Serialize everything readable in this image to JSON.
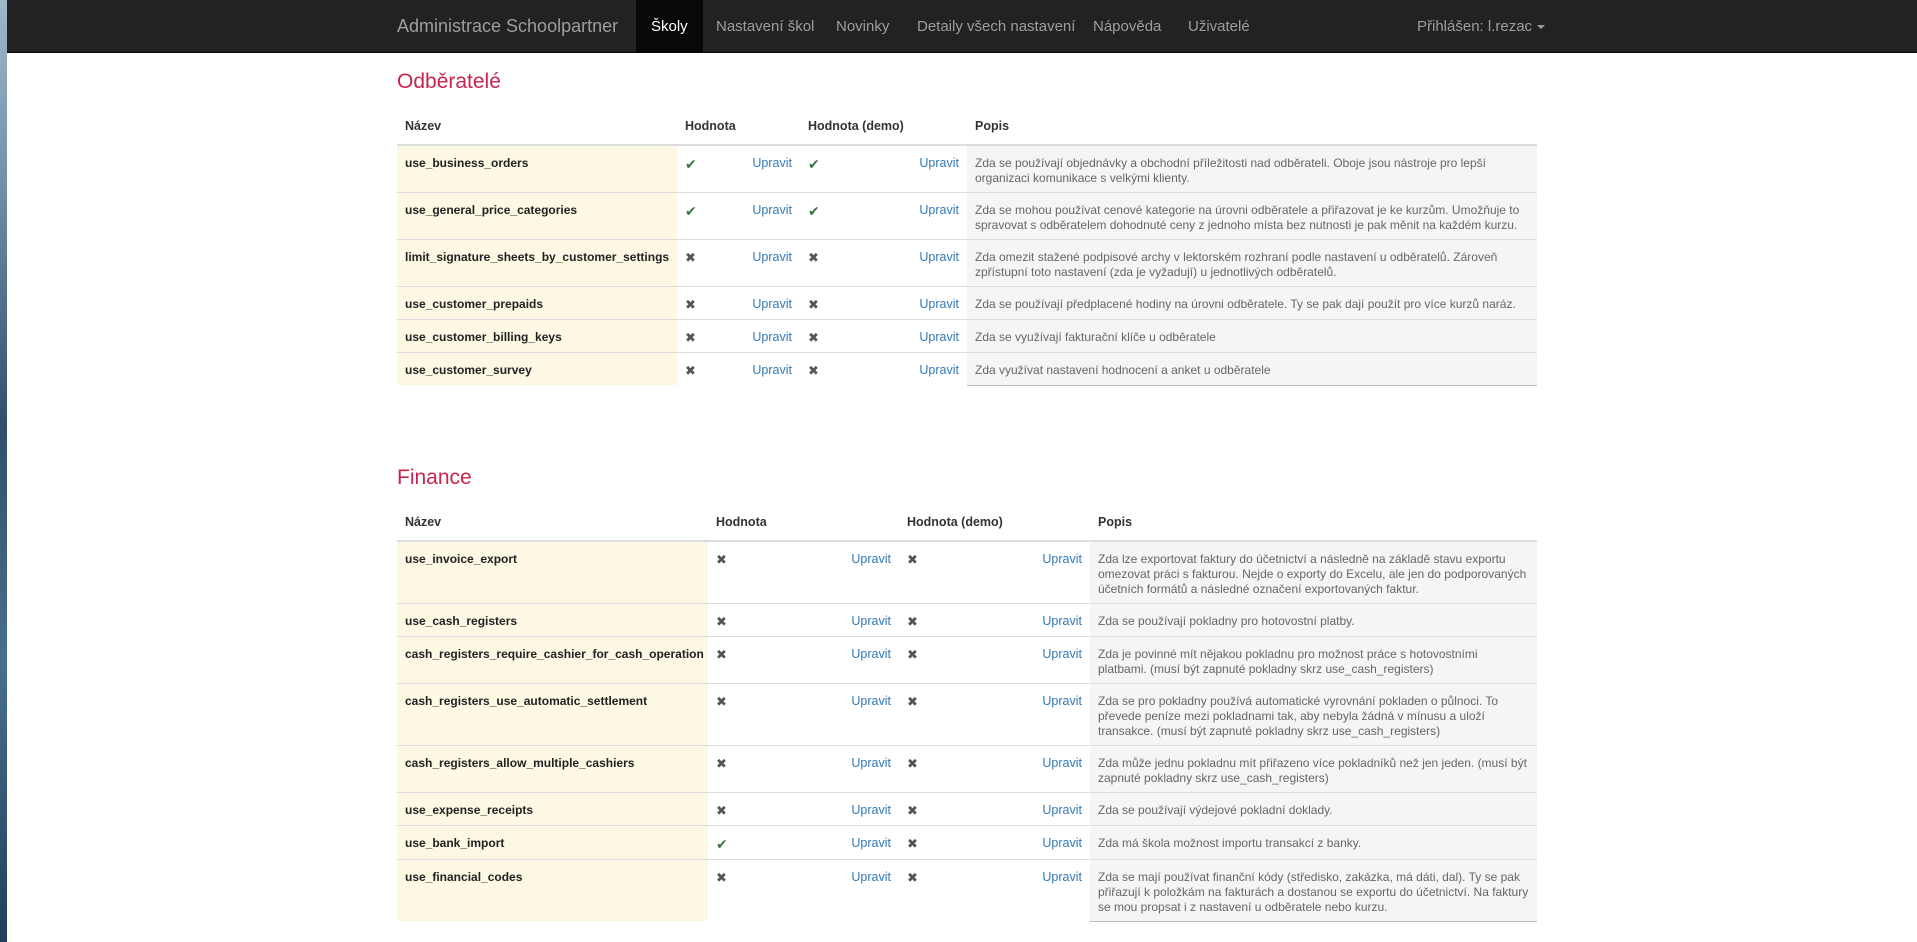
{
  "nav": {
    "brand": "Administrace Schoolpartner",
    "items": [
      "Školy",
      "Nastavení škol",
      "Novinky",
      "Detaily všech nastavení",
      "Nápověda",
      "Uživatelé"
    ],
    "user": "Přihlášen: l.rezac"
  },
  "headers": {
    "name": "Název",
    "value": "Hodnota",
    "value_demo": "Hodnota (demo)",
    "desc": "Popis",
    "edit": "Upravit"
  },
  "sections": [
    {
      "title": "Odběratelé",
      "rows": [
        {
          "name": "use_business_orders",
          "value": "check",
          "demo": "check",
          "desc": "Zda se používají objednávky a obchodní příležitosti nad odběrateli. Oboje jsou nástroje pro lepší organizaci komunikace s velkými klienty."
        },
        {
          "name": "use_general_price_categories",
          "value": "check",
          "demo": "check",
          "desc": "Zda se mohou používat cenové kategorie na úrovni odběratele a přiřazovat je ke kurzům. Umožňuje to spravovat s odběratelem dohodnuté ceny z jednoho místa bez nutnosti je pak měnit na každém kurzu."
        },
        {
          "name": "limit_signature_sheets_by_customer_settings",
          "value": "cross",
          "demo": "cross",
          "desc": "Zda omezit stažené podpisové archy v lektorském rozhraní podle nastavení u odběratelů. Zároveň zpřístupní toto nastavení (zda je vyžadují) u jednotlivých odběratelů."
        },
        {
          "name": "use_customer_prepaids",
          "value": "cross",
          "demo": "cross",
          "desc": "Zda se používají předplacené hodiny na úrovni odběratele. Ty se pak dají použít pro více kurzů naráz."
        },
        {
          "name": "use_customer_billing_keys",
          "value": "cross",
          "demo": "cross",
          "desc": "Zda se využívají fakturační klíče u odběratele"
        },
        {
          "name": "use_customer_survey",
          "value": "cross",
          "demo": "cross",
          "desc": "Zda využívat nastavení hodnocení a anket u odběratele"
        }
      ]
    },
    {
      "title": "Finance",
      "rows": [
        {
          "name": "use_invoice_export",
          "value": "cross",
          "demo": "cross",
          "desc": "Zda lze exportovat faktury do účetnictví a následně na základě stavu exportu omezovat práci s fakturou. Nejde o exporty do Excelu, ale jen do podporovaných účetních formátů a následné označení exportovaných faktur."
        },
        {
          "name": "use_cash_registers",
          "value": "cross",
          "demo": "cross",
          "desc": "Zda se používají pokladny pro hotovostní platby."
        },
        {
          "name": "cash_registers_require_cashier_for_cash_operation",
          "value": "cross",
          "demo": "cross",
          "desc": "Zda je povinné mít nějakou pokladnu pro možnost práce s hotovostními platbami. (musí být zapnuté pokladny skrz use_cash_registers)"
        },
        {
          "name": "cash_registers_use_automatic_settlement",
          "value": "cross",
          "demo": "cross",
          "desc": "Zda se pro pokladny používá automatické vyrovnání pokladen o půlnoci. To převede peníze mezi pokladnami tak, aby nebyla žádná v mínusu a uloží transakce. (musí být zapnuté pokladny skrz use_cash_registers)"
        },
        {
          "name": "cash_registers_allow_multiple_cashiers",
          "value": "cross",
          "demo": "cross",
          "desc": "Zda může jednu pokladnu mít přiřazeno více pokladníků než jen jeden. (musí být zapnuté pokladny skrz use_cash_registers)"
        },
        {
          "name": "use_expense_receipts",
          "value": "cross",
          "demo": "cross",
          "desc": "Zda se používají výdejové pokladní doklady."
        },
        {
          "name": "use_bank_import",
          "value": "check",
          "demo": "cross",
          "desc": "Zda má škola možnost importu transakcí z banky."
        },
        {
          "name": "use_financial_codes",
          "value": "cross",
          "demo": "cross",
          "desc": "Zda se mají používat finanční kódy (středisko, zakázka, má dáti, dal). Ty se pak přiřazují k položkám na fakturách a dostanou se exportu do účetnictví. Na faktury se mou propsat i z nastavení u odběratele nebo kurzu."
        }
      ]
    }
  ]
}
